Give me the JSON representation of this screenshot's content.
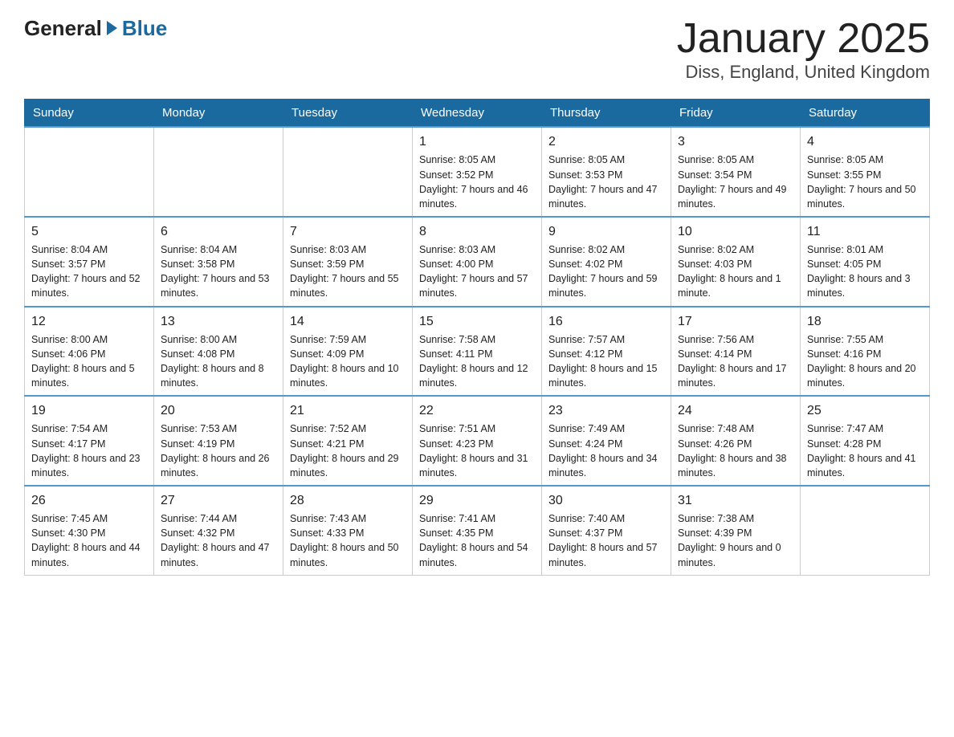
{
  "logo": {
    "general": "General",
    "blue": "Blue"
  },
  "title": "January 2025",
  "subtitle": "Diss, England, United Kingdom",
  "days_of_week": [
    "Sunday",
    "Monday",
    "Tuesday",
    "Wednesday",
    "Thursday",
    "Friday",
    "Saturday"
  ],
  "weeks": [
    [
      {
        "day": "",
        "sunrise": "",
        "sunset": "",
        "daylight": ""
      },
      {
        "day": "",
        "sunrise": "",
        "sunset": "",
        "daylight": ""
      },
      {
        "day": "",
        "sunrise": "",
        "sunset": "",
        "daylight": ""
      },
      {
        "day": "1",
        "sunrise": "Sunrise: 8:05 AM",
        "sunset": "Sunset: 3:52 PM",
        "daylight": "Daylight: 7 hours and 46 minutes."
      },
      {
        "day": "2",
        "sunrise": "Sunrise: 8:05 AM",
        "sunset": "Sunset: 3:53 PM",
        "daylight": "Daylight: 7 hours and 47 minutes."
      },
      {
        "day": "3",
        "sunrise": "Sunrise: 8:05 AM",
        "sunset": "Sunset: 3:54 PM",
        "daylight": "Daylight: 7 hours and 49 minutes."
      },
      {
        "day": "4",
        "sunrise": "Sunrise: 8:05 AM",
        "sunset": "Sunset: 3:55 PM",
        "daylight": "Daylight: 7 hours and 50 minutes."
      }
    ],
    [
      {
        "day": "5",
        "sunrise": "Sunrise: 8:04 AM",
        "sunset": "Sunset: 3:57 PM",
        "daylight": "Daylight: 7 hours and 52 minutes."
      },
      {
        "day": "6",
        "sunrise": "Sunrise: 8:04 AM",
        "sunset": "Sunset: 3:58 PM",
        "daylight": "Daylight: 7 hours and 53 minutes."
      },
      {
        "day": "7",
        "sunrise": "Sunrise: 8:03 AM",
        "sunset": "Sunset: 3:59 PM",
        "daylight": "Daylight: 7 hours and 55 minutes."
      },
      {
        "day": "8",
        "sunrise": "Sunrise: 8:03 AM",
        "sunset": "Sunset: 4:00 PM",
        "daylight": "Daylight: 7 hours and 57 minutes."
      },
      {
        "day": "9",
        "sunrise": "Sunrise: 8:02 AM",
        "sunset": "Sunset: 4:02 PM",
        "daylight": "Daylight: 7 hours and 59 minutes."
      },
      {
        "day": "10",
        "sunrise": "Sunrise: 8:02 AM",
        "sunset": "Sunset: 4:03 PM",
        "daylight": "Daylight: 8 hours and 1 minute."
      },
      {
        "day": "11",
        "sunrise": "Sunrise: 8:01 AM",
        "sunset": "Sunset: 4:05 PM",
        "daylight": "Daylight: 8 hours and 3 minutes."
      }
    ],
    [
      {
        "day": "12",
        "sunrise": "Sunrise: 8:00 AM",
        "sunset": "Sunset: 4:06 PM",
        "daylight": "Daylight: 8 hours and 5 minutes."
      },
      {
        "day": "13",
        "sunrise": "Sunrise: 8:00 AM",
        "sunset": "Sunset: 4:08 PM",
        "daylight": "Daylight: 8 hours and 8 minutes."
      },
      {
        "day": "14",
        "sunrise": "Sunrise: 7:59 AM",
        "sunset": "Sunset: 4:09 PM",
        "daylight": "Daylight: 8 hours and 10 minutes."
      },
      {
        "day": "15",
        "sunrise": "Sunrise: 7:58 AM",
        "sunset": "Sunset: 4:11 PM",
        "daylight": "Daylight: 8 hours and 12 minutes."
      },
      {
        "day": "16",
        "sunrise": "Sunrise: 7:57 AM",
        "sunset": "Sunset: 4:12 PM",
        "daylight": "Daylight: 8 hours and 15 minutes."
      },
      {
        "day": "17",
        "sunrise": "Sunrise: 7:56 AM",
        "sunset": "Sunset: 4:14 PM",
        "daylight": "Daylight: 8 hours and 17 minutes."
      },
      {
        "day": "18",
        "sunrise": "Sunrise: 7:55 AM",
        "sunset": "Sunset: 4:16 PM",
        "daylight": "Daylight: 8 hours and 20 minutes."
      }
    ],
    [
      {
        "day": "19",
        "sunrise": "Sunrise: 7:54 AM",
        "sunset": "Sunset: 4:17 PM",
        "daylight": "Daylight: 8 hours and 23 minutes."
      },
      {
        "day": "20",
        "sunrise": "Sunrise: 7:53 AM",
        "sunset": "Sunset: 4:19 PM",
        "daylight": "Daylight: 8 hours and 26 minutes."
      },
      {
        "day": "21",
        "sunrise": "Sunrise: 7:52 AM",
        "sunset": "Sunset: 4:21 PM",
        "daylight": "Daylight: 8 hours and 29 minutes."
      },
      {
        "day": "22",
        "sunrise": "Sunrise: 7:51 AM",
        "sunset": "Sunset: 4:23 PM",
        "daylight": "Daylight: 8 hours and 31 minutes."
      },
      {
        "day": "23",
        "sunrise": "Sunrise: 7:49 AM",
        "sunset": "Sunset: 4:24 PM",
        "daylight": "Daylight: 8 hours and 34 minutes."
      },
      {
        "day": "24",
        "sunrise": "Sunrise: 7:48 AM",
        "sunset": "Sunset: 4:26 PM",
        "daylight": "Daylight: 8 hours and 38 minutes."
      },
      {
        "day": "25",
        "sunrise": "Sunrise: 7:47 AM",
        "sunset": "Sunset: 4:28 PM",
        "daylight": "Daylight: 8 hours and 41 minutes."
      }
    ],
    [
      {
        "day": "26",
        "sunrise": "Sunrise: 7:45 AM",
        "sunset": "Sunset: 4:30 PM",
        "daylight": "Daylight: 8 hours and 44 minutes."
      },
      {
        "day": "27",
        "sunrise": "Sunrise: 7:44 AM",
        "sunset": "Sunset: 4:32 PM",
        "daylight": "Daylight: 8 hours and 47 minutes."
      },
      {
        "day": "28",
        "sunrise": "Sunrise: 7:43 AM",
        "sunset": "Sunset: 4:33 PM",
        "daylight": "Daylight: 8 hours and 50 minutes."
      },
      {
        "day": "29",
        "sunrise": "Sunrise: 7:41 AM",
        "sunset": "Sunset: 4:35 PM",
        "daylight": "Daylight: 8 hours and 54 minutes."
      },
      {
        "day": "30",
        "sunrise": "Sunrise: 7:40 AM",
        "sunset": "Sunset: 4:37 PM",
        "daylight": "Daylight: 8 hours and 57 minutes."
      },
      {
        "day": "31",
        "sunrise": "Sunrise: 7:38 AM",
        "sunset": "Sunset: 4:39 PM",
        "daylight": "Daylight: 9 hours and 0 minutes."
      },
      {
        "day": "",
        "sunrise": "",
        "sunset": "",
        "daylight": ""
      }
    ]
  ]
}
